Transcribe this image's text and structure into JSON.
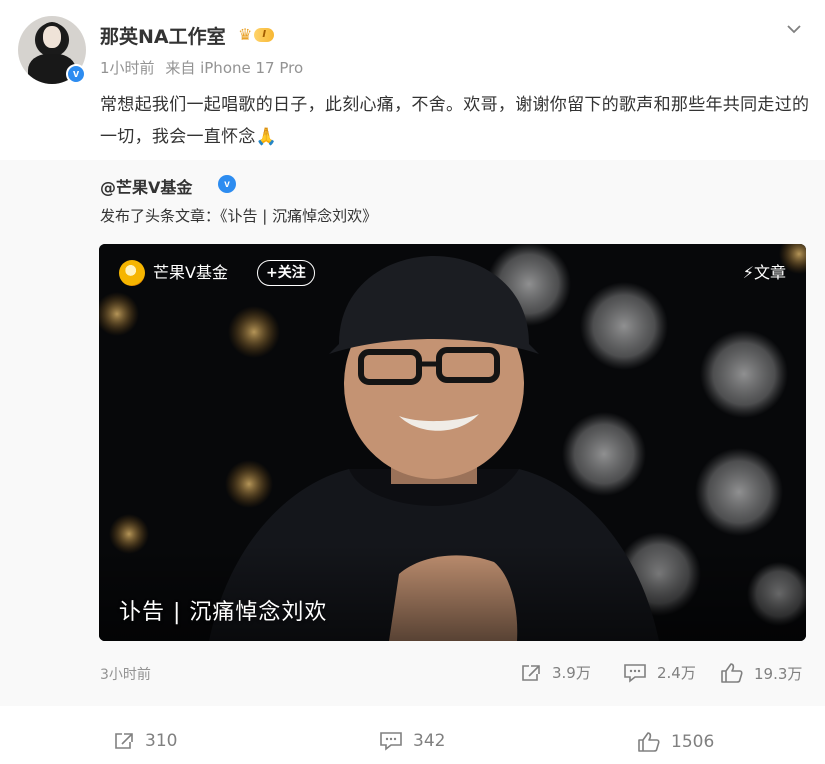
{
  "post": {
    "username": "那英NA工作室",
    "level_badge": "I",
    "time": "1小时前",
    "source": "来自 iPhone 17 Pro",
    "text": "常想起我们一起唱歌的日子，此刻心痛，不舍。欢哥，谢谢你留下的歌声和那些年共同走过的一切，我会一直怀念🙏"
  },
  "repost": {
    "author": "@芒果V基金",
    "description": "发布了头条文章：《讣告 | 沉痛悼念刘欢》",
    "card": {
      "author": "芒果V基金",
      "follow_label": "+关注",
      "tag": "⚡文章",
      "title": "讣告 | 沉痛悼念刘欢"
    },
    "time": "3小时前",
    "stats": {
      "share": "3.9万",
      "comment": "2.4万",
      "like": "19.3万"
    }
  },
  "stats": {
    "share": "310",
    "comment": "342",
    "like": "1506"
  },
  "icons": {
    "verified": "verified-icon",
    "crown": "crown-icon",
    "menu": "chevron-down-icon",
    "share": "share-icon",
    "comment": "comment-icon",
    "like": "like-icon"
  },
  "colors": {
    "verified_blue": "#2d8cf0",
    "meta_gray": "#939393",
    "repost_bg": "#f9f9f9"
  }
}
